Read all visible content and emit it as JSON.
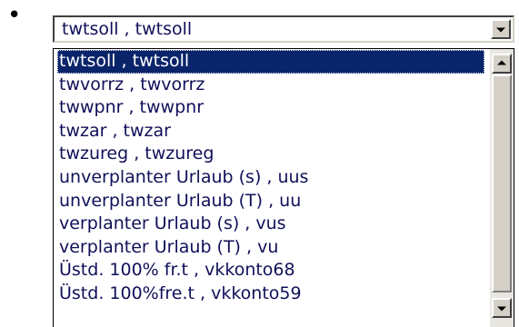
{
  "bullet": "•",
  "combo": {
    "value": "twtsoll , twtsoll",
    "dropdown_icon": "chevron-down-icon"
  },
  "list": {
    "selected_index": 0,
    "options": [
      "twtsoll , twtsoll",
      "twvorrz , twvorrz",
      "twwpnr , twwpnr",
      "twzar , twzar",
      "twzureg , twzureg",
      "unverplanter Urlaub (s) , uus",
      "unverplanter Urlaub (T) , uu",
      "verplanter Urlaub (s) , vus",
      "verplanter Urlaub (T) , vu",
      "Üstd. 100% fr.t , vkkonto68",
      "Üstd. 100%fre.t , vkkonto59"
    ],
    "scroll_up_icon": "arrow-up-icon",
    "scroll_down_icon": "arrow-down-icon"
  },
  "colors": {
    "selection_bg": "#0a246a",
    "selection_text": "#ffffff",
    "item_text": "#10105a",
    "button_face": "#d4d0c8"
  }
}
